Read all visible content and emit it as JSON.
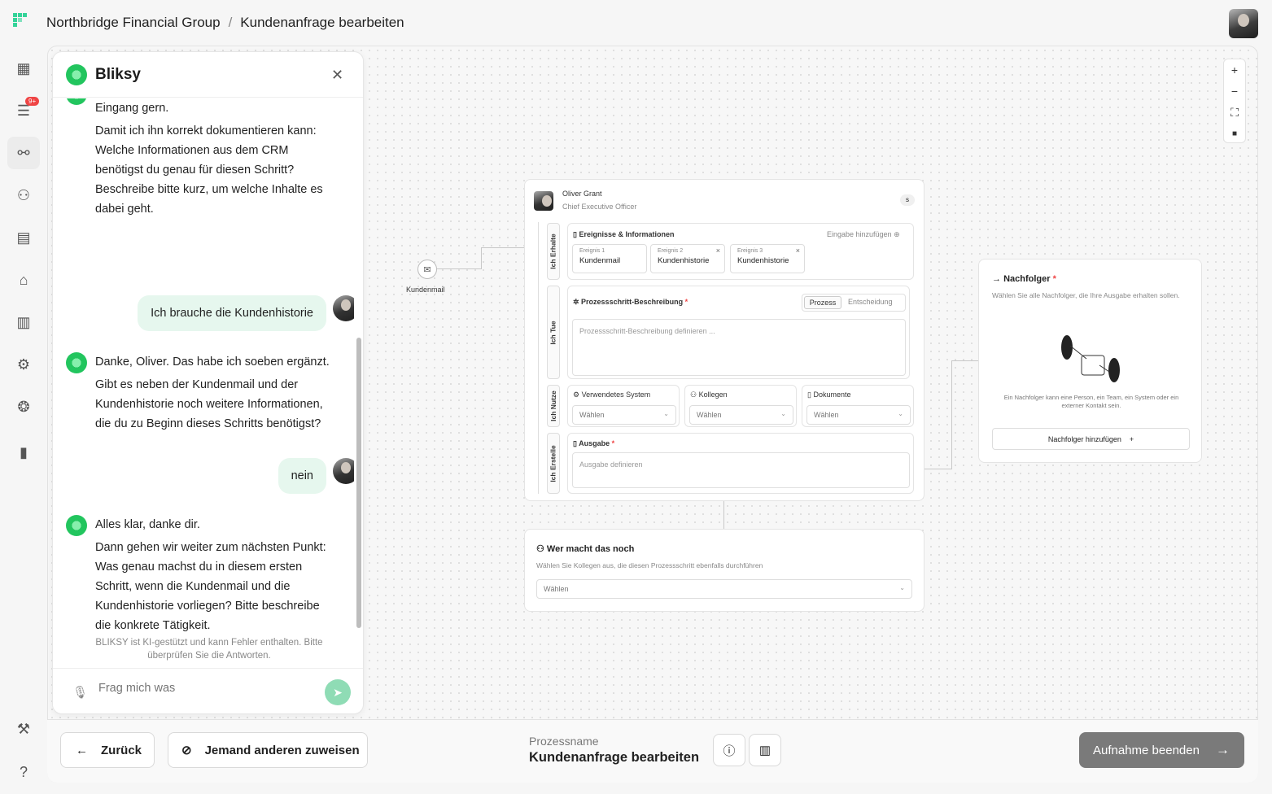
{
  "breadcrumb": {
    "org": "Northbridge Financial Group",
    "separator": "/",
    "page": "Kundenanfrage bearbeiten"
  },
  "sidebar": {
    "items": [
      {
        "name": "dashboard-icon",
        "glyph": "▦"
      },
      {
        "name": "tasks-icon",
        "glyph": "☰",
        "badge": "9+"
      },
      {
        "name": "process-icon",
        "glyph": "⚯",
        "active": true
      },
      {
        "name": "people-icon",
        "glyph": "⚇"
      },
      {
        "name": "server-icon",
        "glyph": "▤"
      },
      {
        "name": "org-user-icon",
        "glyph": "⌂"
      },
      {
        "name": "documents-icon",
        "glyph": "▥"
      },
      {
        "name": "settings-icon",
        "glyph": "⚙"
      },
      {
        "name": "brain-icon",
        "glyph": "❂"
      },
      {
        "name": "chart-icon",
        "glyph": "▮"
      }
    ],
    "bottom": [
      {
        "name": "wrench-icon",
        "glyph": "⚒"
      },
      {
        "name": "help-icon",
        "glyph": "?"
      }
    ]
  },
  "chat": {
    "title": "Bliksy",
    "messages": {
      "m1_line1": "Eingang gern.",
      "m1_line2": "Damit ich ihn korrekt dokumentieren kann: Welche Informationen aus dem CRM benötigst du genau für diesen Schritt? Beschreibe bitte kurz, um welche Inhalte es dabei geht.",
      "u1": "Ich brauche die Kundenhistorie",
      "m2_line1": "Danke, Oliver. Das habe ich soeben ergänzt.",
      "m2_line2": "Gibt es neben der Kundenmail und der Kundenhistorie noch weitere Informationen, die du zu Beginn dieses Schritts benötigst?",
      "u2": "nein",
      "m3_line1": "Alles klar, danke dir.",
      "m3_line2": "Dann gehen wir weiter zum nächsten Punkt: Was genau machst du in diesem ersten Schritt, wenn die Kundenmail und die Kundenhistorie vorliegen? Bitte beschreibe die konkrete Tätigkeit."
    },
    "disclaimer": "BLIKSY ist KI-gestützt und kann Fehler enthalten. Bitte überprüfen Sie die Antworten.",
    "input_placeholder": "Frag mich was"
  },
  "zoom_controls": [
    "+",
    "−",
    "⛶",
    "🔒"
  ],
  "trigger": {
    "label": "Kundenmail"
  },
  "step": {
    "owner_name": "Oliver Grant",
    "owner_role": "Chief Executive Officer",
    "owner_badge": "s",
    "lanes": {
      "receive": "Ich Erhalte",
      "do": "Ich Tue",
      "use": "Ich Nutze",
      "create": "Ich Erstelle"
    },
    "events_title": "Ereignisse & Informationen",
    "add_input": "Eingabe hinzufügen",
    "events": [
      {
        "key": "Ereignis 1",
        "value": "Kundenmail"
      },
      {
        "key": "Ereignis 2",
        "value": "Kundenhistorie"
      },
      {
        "key": "Ereignis 3",
        "value": "Kundenhistorie"
      }
    ],
    "description_title": "Prozessschritt-Beschreibung",
    "required_mark": "*",
    "toggle": [
      "Prozess",
      "Entscheidung"
    ],
    "description_placeholder": "Prozessschritt-Beschreibung definieren ...",
    "system_label": "Verwendetes System",
    "colleagues_label": "Kollegen",
    "documents_label": "Dokumente",
    "select_placeholder": "Wählen",
    "output_title": "Ausgabe",
    "output_placeholder": "Ausgabe definieren"
  },
  "who_else": {
    "title": "Wer macht das noch",
    "subtitle": "Wählen Sie Kollegen aus, die diesen Prozessschritt ebenfalls durchführen",
    "select": "Wählen"
  },
  "successor": {
    "title": "Nachfolger",
    "subtitle": "Wählen Sie alle Nachfolger, die Ihre Ausgabe erhalten sollen.",
    "note": "Ein Nachfolger kann eine Person, ein Team, ein System oder ein externer Kontakt sein.",
    "button": "Nachfolger hinzufügen"
  },
  "footer": {
    "back": "Zurück",
    "assign": "Jemand anderen zuweisen",
    "process_label": "Prozessname",
    "process_name": "Kundenanfrage bearbeiten",
    "finish": "Aufnahme beenden"
  },
  "colors": {
    "accent": "#22c55e",
    "bubble": "#e6f7ee",
    "finish": "#7a7a7a",
    "required": "#ef4444"
  }
}
